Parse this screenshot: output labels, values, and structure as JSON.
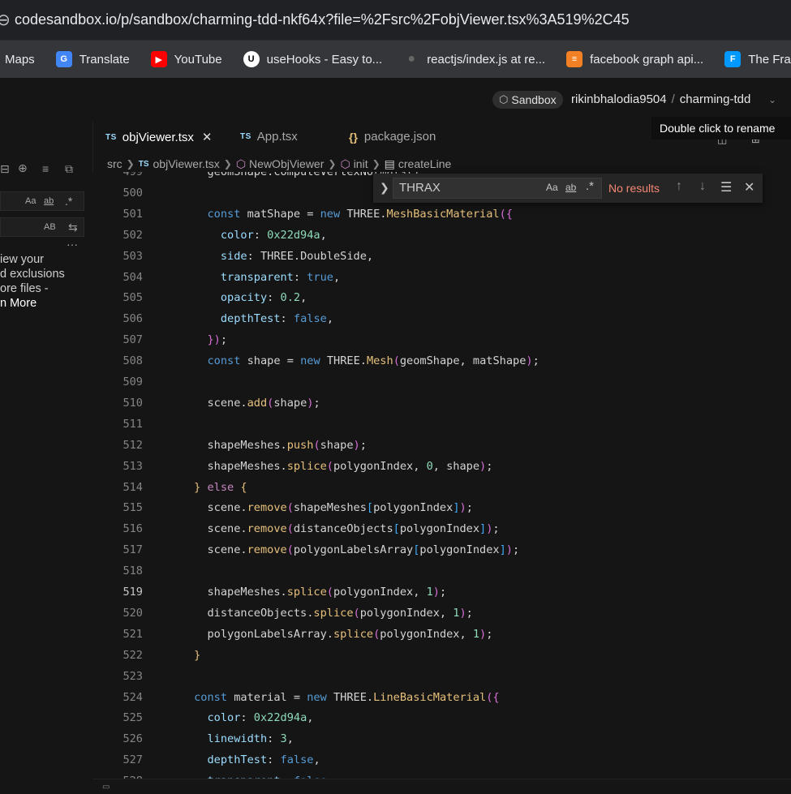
{
  "browser": {
    "url": "codesandbox.io/p/sandbox/charming-tdd-nkf64x?file=%2Fsrc%2FobjViewer.tsx%3A519%2C45",
    "bookmarks": [
      {
        "label": "Maps",
        "icon": "maps-icon",
        "color": "#35363a"
      },
      {
        "label": "Translate",
        "icon": "translate-icon",
        "color": "#4285f4"
      },
      {
        "label": "YouTube",
        "icon": "youtube-icon",
        "color": "#ff0000"
      },
      {
        "label": "useHooks - Easy to...",
        "icon": "usehooks-icon",
        "color": "#ffffff"
      },
      {
        "label": "reactjs/index.js at re...",
        "icon": "github-icon",
        "color": "#35363a"
      },
      {
        "label": "facebook graph api...",
        "icon": "stackoverflow-icon",
        "color": "#f48024"
      },
      {
        "label": "The Framer I",
        "icon": "framer-icon",
        "color": "#0099ff"
      }
    ]
  },
  "header": {
    "sandbox_label": "Sandbox",
    "owner": "rikinbhalodia9504",
    "separator": "/",
    "project": "charming-tdd",
    "tooltip": "Double click to rename"
  },
  "sidebar": {
    "case_label": "Aa",
    "word_label": "ab",
    "regex_label": ".*",
    "preserve_case_label": "AB",
    "more_label": "···",
    "message_lines": [
      "iew your",
      "d exclusions",
      "ore files -",
      "n More"
    ]
  },
  "tabs": [
    {
      "label": "objViewer.tsx",
      "badge": "TS",
      "active": true
    },
    {
      "label": "App.tsx",
      "badge": "TS",
      "active": false
    },
    {
      "label": "package.json",
      "badge": "{}",
      "active": false
    }
  ],
  "breadcrumb": [
    "src",
    "objViewer.tsx",
    "NewObjViewer",
    "init",
    "createLine"
  ],
  "find": {
    "query": "THRAX",
    "case_label": "Aa",
    "word_label": "ab",
    "regex_label": ".*",
    "result": "No results"
  },
  "editor": {
    "current_line": 519,
    "lines": [
      {
        "n": "499",
        "tokens": [
          [
            "        geomShape.computeVertexNormals();",
            ""
          ]
        ]
      },
      {
        "n": "500",
        "tokens": []
      },
      {
        "n": "501",
        "tokens": [
          [
            "        ",
            ""
          ],
          [
            "const ",
            "kw"
          ],
          [
            "matShape = ",
            ""
          ],
          [
            "new ",
            "kw"
          ],
          [
            "THREE.",
            ""
          ],
          [
            "MeshBasicMaterial",
            "fn"
          ],
          [
            "({",
            "pv"
          ]
        ]
      },
      {
        "n": "502",
        "tokens": [
          [
            "          ",
            ""
          ],
          [
            "color",
            "prop"
          ],
          [
            ": ",
            ""
          ],
          [
            "0x22d94a",
            "num"
          ],
          [
            ",",
            ""
          ]
        ]
      },
      {
        "n": "503",
        "tokens": [
          [
            "          ",
            ""
          ],
          [
            "side",
            "prop"
          ],
          [
            ": THREE.DoubleSide,",
            ""
          ]
        ]
      },
      {
        "n": "504",
        "tokens": [
          [
            "          ",
            ""
          ],
          [
            "transparent",
            "prop"
          ],
          [
            ": ",
            ""
          ],
          [
            "true",
            "kw"
          ],
          [
            ",",
            ""
          ]
        ]
      },
      {
        "n": "505",
        "tokens": [
          [
            "          ",
            ""
          ],
          [
            "opacity",
            "prop"
          ],
          [
            ": ",
            ""
          ],
          [
            "0.2",
            "num"
          ],
          [
            ",",
            ""
          ]
        ]
      },
      {
        "n": "506",
        "tokens": [
          [
            "          ",
            ""
          ],
          [
            "depthTest",
            "prop"
          ],
          [
            ": ",
            ""
          ],
          [
            "false",
            "kw"
          ],
          [
            ",",
            ""
          ]
        ]
      },
      {
        "n": "507",
        "tokens": [
          [
            "        ",
            ""
          ],
          [
            "})",
            "pv"
          ],
          [
            ";",
            ""
          ]
        ]
      },
      {
        "n": "508",
        "tokens": [
          [
            "        ",
            ""
          ],
          [
            "const ",
            "kw"
          ],
          [
            "shape = ",
            ""
          ],
          [
            "new ",
            "kw"
          ],
          [
            "THREE.",
            ""
          ],
          [
            "Mesh",
            "fn"
          ],
          [
            "(",
            "pv"
          ],
          [
            "geomShape, matShape",
            ""
          ],
          [
            ")",
            "pv"
          ],
          [
            ";",
            ""
          ]
        ]
      },
      {
        "n": "509",
        "tokens": []
      },
      {
        "n": "510",
        "tokens": [
          [
            "        scene.",
            ""
          ],
          [
            "add",
            "fn"
          ],
          [
            "(",
            "pv"
          ],
          [
            "shape",
            ""
          ],
          [
            ")",
            "pv"
          ],
          [
            ";",
            ""
          ]
        ]
      },
      {
        "n": "511",
        "tokens": []
      },
      {
        "n": "512",
        "tokens": [
          [
            "        shapeMeshes.",
            ""
          ],
          [
            "push",
            "fn"
          ],
          [
            "(",
            "pv"
          ],
          [
            "shape",
            ""
          ],
          [
            ")",
            "pv"
          ],
          [
            ";",
            ""
          ]
        ]
      },
      {
        "n": "513",
        "tokens": [
          [
            "        shapeMeshes.",
            ""
          ],
          [
            "splice",
            "fn"
          ],
          [
            "(",
            "pv"
          ],
          [
            "polygonIndex, ",
            ""
          ],
          [
            "0",
            "num"
          ],
          [
            ", shape",
            ""
          ],
          [
            ")",
            "pv"
          ],
          [
            ";",
            ""
          ]
        ]
      },
      {
        "n": "514",
        "tokens": [
          [
            "      ",
            ""
          ],
          [
            "}",
            "pn"
          ],
          [
            " ",
            ""
          ],
          [
            "else",
            "kw2"
          ],
          [
            " ",
            ""
          ],
          [
            "{",
            "pn"
          ]
        ]
      },
      {
        "n": "515",
        "tokens": [
          [
            "        scene.",
            ""
          ],
          [
            "remove",
            "fn"
          ],
          [
            "(",
            "pv"
          ],
          [
            "shapeMeshes",
            ""
          ],
          [
            "[",
            "pb"
          ],
          [
            "polygonIndex",
            ""
          ],
          [
            "]",
            "pb"
          ],
          [
            ")",
            "pv"
          ],
          [
            ";",
            ""
          ]
        ]
      },
      {
        "n": "516",
        "tokens": [
          [
            "        scene.",
            ""
          ],
          [
            "remove",
            "fn"
          ],
          [
            "(",
            "pv"
          ],
          [
            "distanceObjects",
            ""
          ],
          [
            "[",
            "pb"
          ],
          [
            "polygonIndex",
            ""
          ],
          [
            "]",
            "pb"
          ],
          [
            ")",
            "pv"
          ],
          [
            ";",
            ""
          ]
        ]
      },
      {
        "n": "517",
        "tokens": [
          [
            "        scene.",
            ""
          ],
          [
            "remove",
            "fn"
          ],
          [
            "(",
            "pv"
          ],
          [
            "polygonLabelsArray",
            ""
          ],
          [
            "[",
            "pb"
          ],
          [
            "polygonIndex",
            ""
          ],
          [
            "]",
            "pb"
          ],
          [
            ")",
            "pv"
          ],
          [
            ";",
            ""
          ]
        ]
      },
      {
        "n": "518",
        "tokens": []
      },
      {
        "n": "519",
        "tokens": [
          [
            "        shapeMeshes.",
            ""
          ],
          [
            "splice",
            "fn"
          ],
          [
            "(",
            "pv"
          ],
          [
            "polygonIndex, ",
            ""
          ],
          [
            "1",
            "num"
          ],
          [
            ")",
            "pv"
          ],
          [
            ";",
            ""
          ]
        ]
      },
      {
        "n": "520",
        "tokens": [
          [
            "        distanceObjects.",
            ""
          ],
          [
            "splice",
            "fn"
          ],
          [
            "(",
            "pv"
          ],
          [
            "polygonIndex, ",
            ""
          ],
          [
            "1",
            "num"
          ],
          [
            ")",
            "pv"
          ],
          [
            ";",
            ""
          ]
        ]
      },
      {
        "n": "521",
        "tokens": [
          [
            "        polygonLabelsArray.",
            ""
          ],
          [
            "splice",
            "fn"
          ],
          [
            "(",
            "pv"
          ],
          [
            "polygonIndex, ",
            ""
          ],
          [
            "1",
            "num"
          ],
          [
            ")",
            "pv"
          ],
          [
            ";",
            ""
          ]
        ]
      },
      {
        "n": "522",
        "tokens": [
          [
            "      ",
            ""
          ],
          [
            "}",
            "pn"
          ]
        ]
      },
      {
        "n": "523",
        "tokens": []
      },
      {
        "n": "524",
        "tokens": [
          [
            "      ",
            ""
          ],
          [
            "const ",
            "kw"
          ],
          [
            "material = ",
            ""
          ],
          [
            "new ",
            "kw"
          ],
          [
            "THREE.",
            ""
          ],
          [
            "LineBasicMaterial",
            "fn"
          ],
          [
            "({",
            "pv"
          ]
        ]
      },
      {
        "n": "525",
        "tokens": [
          [
            "        ",
            ""
          ],
          [
            "color",
            "prop"
          ],
          [
            ": ",
            ""
          ],
          [
            "0x22d94a",
            "num"
          ],
          [
            ",",
            ""
          ]
        ]
      },
      {
        "n": "526",
        "tokens": [
          [
            "        ",
            ""
          ],
          [
            "linewidth",
            "prop"
          ],
          [
            ": ",
            ""
          ],
          [
            "3",
            "num"
          ],
          [
            ",",
            ""
          ]
        ]
      },
      {
        "n": "527",
        "tokens": [
          [
            "        ",
            ""
          ],
          [
            "depthTest",
            "prop"
          ],
          [
            ": ",
            ""
          ],
          [
            "false",
            "kw"
          ],
          [
            ",",
            ""
          ]
        ]
      },
      {
        "n": "528",
        "tokens": [
          [
            "        ",
            ""
          ],
          [
            "transparent",
            "prop"
          ],
          [
            ": ",
            ""
          ],
          [
            "false",
            "kw"
          ],
          [
            ",",
            ""
          ]
        ]
      }
    ]
  }
}
